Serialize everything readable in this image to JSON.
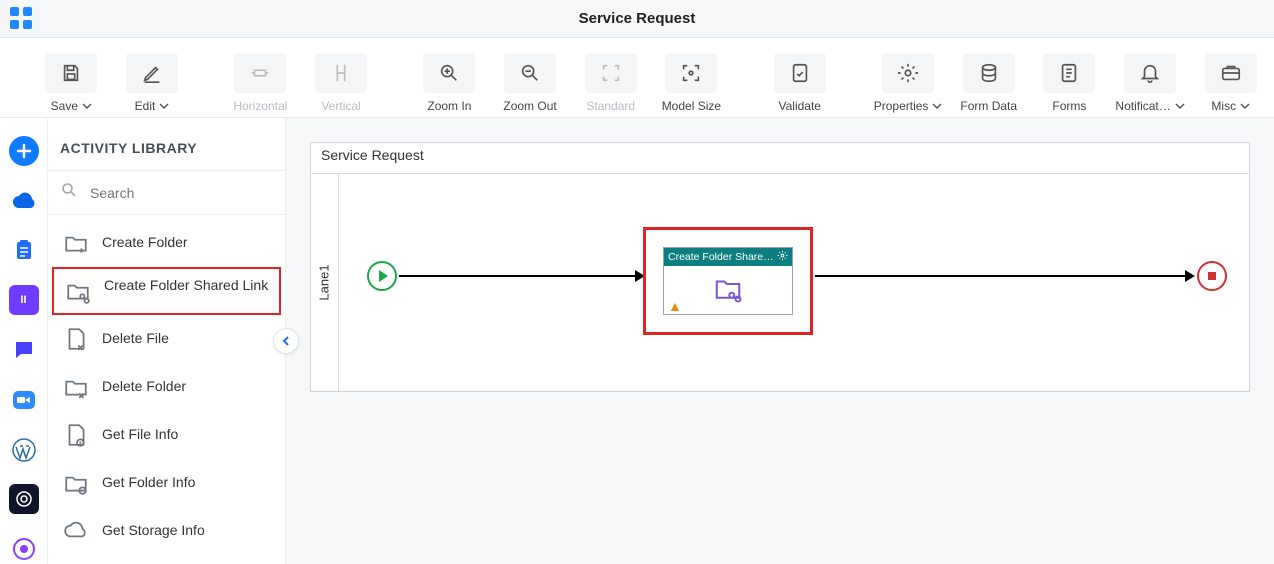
{
  "header": {
    "title": "Service Request"
  },
  "toolbar": {
    "save": "Save",
    "edit": "Edit",
    "horizontal": "Horizontal",
    "vertical": "Vertical",
    "zoom_in": "Zoom In",
    "zoom_out": "Zoom Out",
    "standard": "Standard",
    "model_size": "Model Size",
    "validate": "Validate",
    "properties": "Properties",
    "form_data": "Form Data",
    "forms": "Forms",
    "notifications": "Notificat…",
    "misc": "Misc"
  },
  "sidebar": {
    "title": "ACTIVITY LIBRARY",
    "search_placeholder": "Search",
    "items": [
      {
        "label": "Create Folder"
      },
      {
        "label": "Create Folder Shared Link"
      },
      {
        "label": "Delete File"
      },
      {
        "label": "Delete Folder"
      },
      {
        "label": "Get File Info"
      },
      {
        "label": "Get Folder Info"
      },
      {
        "label": "Get Storage Info"
      }
    ]
  },
  "canvas": {
    "title": "Service Request",
    "lane": "Lane1",
    "activity_label": "Create Folder Shared…"
  }
}
